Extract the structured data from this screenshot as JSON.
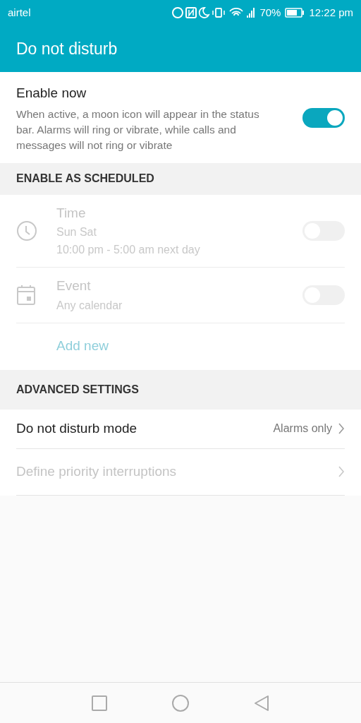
{
  "status_bar": {
    "carrier": "airtel",
    "battery_text": "70%",
    "time": "12:22 pm"
  },
  "app_bar": {
    "title": "Do not disturb"
  },
  "enable_now": {
    "title": "Enable now",
    "description": "When active, a moon icon will appear in the status bar. Alarms will ring or vibrate, while calls and messages will not ring or vibrate",
    "on": true
  },
  "scheduled": {
    "header": "ENABLE AS SCHEDULED",
    "disabled": true,
    "rules": [
      {
        "kind": "time",
        "title": "Time",
        "lines": [
          "Sun Sat",
          "10:00 pm - 5:00 am next day"
        ],
        "on": false
      },
      {
        "kind": "event",
        "title": "Event",
        "lines": [
          "Any calendar"
        ],
        "on": false
      }
    ],
    "add_label": "Add new"
  },
  "advanced": {
    "header": "ADVANCED SETTINGS",
    "items": [
      {
        "label": "Do not disturb mode",
        "value": "Alarms only",
        "disabled": false
      },
      {
        "label": "Define priority interruptions",
        "disabled": true
      }
    ]
  }
}
